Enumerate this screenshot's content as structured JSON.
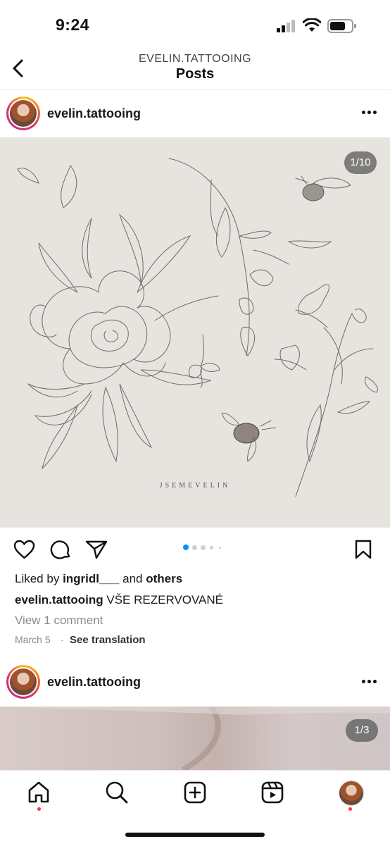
{
  "status_bar": {
    "time": "9:24"
  },
  "header": {
    "subtitle": "EVELIN.TATTOOING",
    "title": "Posts"
  },
  "post1": {
    "username": "evelin.tattooing",
    "image_counter": "1/10",
    "watermark": "JSEMEVELIN",
    "likes_prefix": "Liked by",
    "liked_by_user": "ingridl___",
    "likes_and": "and",
    "likes_others": "others",
    "caption_user": "evelin.tattooing",
    "caption_text": "VŠE REZERVOVANÉ",
    "view_comments": "View 1 comment",
    "date": "March 5",
    "separator": "·",
    "see_translation": "See translation",
    "carousel_total": 5,
    "carousel_active": 1
  },
  "post2": {
    "username": "evelin.tattooing",
    "image_counter": "1/3"
  },
  "tab_bar": {
    "items": [
      "home-icon",
      "search-icon",
      "create-icon",
      "reels-icon",
      "profile-avatar"
    ],
    "active": "home"
  },
  "colors": {
    "accent_blue": "#0095f6",
    "notification_red": "#ff3040",
    "image_background": "#e7e4e0"
  }
}
